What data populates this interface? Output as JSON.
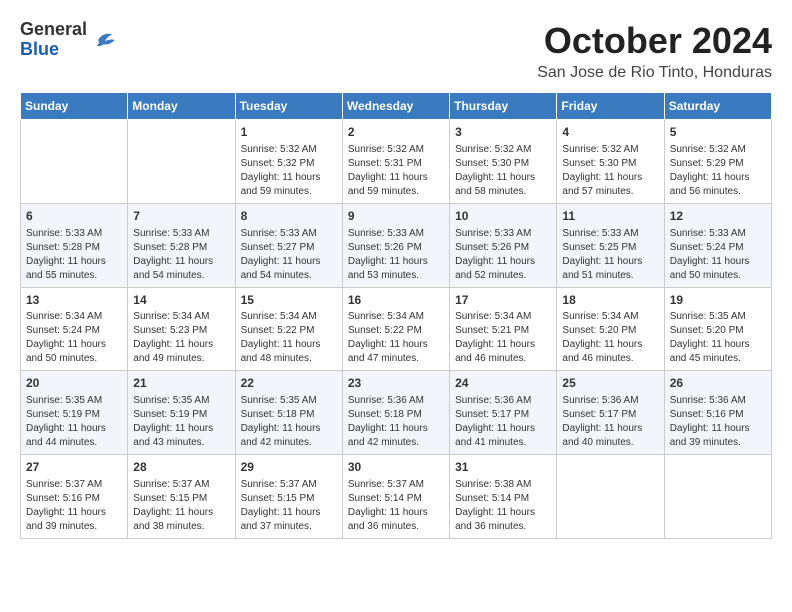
{
  "header": {
    "logo": {
      "line1": "General",
      "line2": "Blue"
    },
    "month_title": "October 2024",
    "location": "San Jose de Rio Tinto, Honduras"
  },
  "weekdays": [
    "Sunday",
    "Monday",
    "Tuesday",
    "Wednesday",
    "Thursday",
    "Friday",
    "Saturday"
  ],
  "weeks": [
    [
      {
        "day": "",
        "info": ""
      },
      {
        "day": "",
        "info": ""
      },
      {
        "day": "1",
        "info": "Sunrise: 5:32 AM\nSunset: 5:32 PM\nDaylight: 11 hours and 59 minutes."
      },
      {
        "day": "2",
        "info": "Sunrise: 5:32 AM\nSunset: 5:31 PM\nDaylight: 11 hours and 59 minutes."
      },
      {
        "day": "3",
        "info": "Sunrise: 5:32 AM\nSunset: 5:30 PM\nDaylight: 11 hours and 58 minutes."
      },
      {
        "day": "4",
        "info": "Sunrise: 5:32 AM\nSunset: 5:30 PM\nDaylight: 11 hours and 57 minutes."
      },
      {
        "day": "5",
        "info": "Sunrise: 5:32 AM\nSunset: 5:29 PM\nDaylight: 11 hours and 56 minutes."
      }
    ],
    [
      {
        "day": "6",
        "info": "Sunrise: 5:33 AM\nSunset: 5:28 PM\nDaylight: 11 hours and 55 minutes."
      },
      {
        "day": "7",
        "info": "Sunrise: 5:33 AM\nSunset: 5:28 PM\nDaylight: 11 hours and 54 minutes."
      },
      {
        "day": "8",
        "info": "Sunrise: 5:33 AM\nSunset: 5:27 PM\nDaylight: 11 hours and 54 minutes."
      },
      {
        "day": "9",
        "info": "Sunrise: 5:33 AM\nSunset: 5:26 PM\nDaylight: 11 hours and 53 minutes."
      },
      {
        "day": "10",
        "info": "Sunrise: 5:33 AM\nSunset: 5:26 PM\nDaylight: 11 hours and 52 minutes."
      },
      {
        "day": "11",
        "info": "Sunrise: 5:33 AM\nSunset: 5:25 PM\nDaylight: 11 hours and 51 minutes."
      },
      {
        "day": "12",
        "info": "Sunrise: 5:33 AM\nSunset: 5:24 PM\nDaylight: 11 hours and 50 minutes."
      }
    ],
    [
      {
        "day": "13",
        "info": "Sunrise: 5:34 AM\nSunset: 5:24 PM\nDaylight: 11 hours and 50 minutes."
      },
      {
        "day": "14",
        "info": "Sunrise: 5:34 AM\nSunset: 5:23 PM\nDaylight: 11 hours and 49 minutes."
      },
      {
        "day": "15",
        "info": "Sunrise: 5:34 AM\nSunset: 5:22 PM\nDaylight: 11 hours and 48 minutes."
      },
      {
        "day": "16",
        "info": "Sunrise: 5:34 AM\nSunset: 5:22 PM\nDaylight: 11 hours and 47 minutes."
      },
      {
        "day": "17",
        "info": "Sunrise: 5:34 AM\nSunset: 5:21 PM\nDaylight: 11 hours and 46 minutes."
      },
      {
        "day": "18",
        "info": "Sunrise: 5:34 AM\nSunset: 5:20 PM\nDaylight: 11 hours and 46 minutes."
      },
      {
        "day": "19",
        "info": "Sunrise: 5:35 AM\nSunset: 5:20 PM\nDaylight: 11 hours and 45 minutes."
      }
    ],
    [
      {
        "day": "20",
        "info": "Sunrise: 5:35 AM\nSunset: 5:19 PM\nDaylight: 11 hours and 44 minutes."
      },
      {
        "day": "21",
        "info": "Sunrise: 5:35 AM\nSunset: 5:19 PM\nDaylight: 11 hours and 43 minutes."
      },
      {
        "day": "22",
        "info": "Sunrise: 5:35 AM\nSunset: 5:18 PM\nDaylight: 11 hours and 42 minutes."
      },
      {
        "day": "23",
        "info": "Sunrise: 5:36 AM\nSunset: 5:18 PM\nDaylight: 11 hours and 42 minutes."
      },
      {
        "day": "24",
        "info": "Sunrise: 5:36 AM\nSunset: 5:17 PM\nDaylight: 11 hours and 41 minutes."
      },
      {
        "day": "25",
        "info": "Sunrise: 5:36 AM\nSunset: 5:17 PM\nDaylight: 11 hours and 40 minutes."
      },
      {
        "day": "26",
        "info": "Sunrise: 5:36 AM\nSunset: 5:16 PM\nDaylight: 11 hours and 39 minutes."
      }
    ],
    [
      {
        "day": "27",
        "info": "Sunrise: 5:37 AM\nSunset: 5:16 PM\nDaylight: 11 hours and 39 minutes."
      },
      {
        "day": "28",
        "info": "Sunrise: 5:37 AM\nSunset: 5:15 PM\nDaylight: 11 hours and 38 minutes."
      },
      {
        "day": "29",
        "info": "Sunrise: 5:37 AM\nSunset: 5:15 PM\nDaylight: 11 hours and 37 minutes."
      },
      {
        "day": "30",
        "info": "Sunrise: 5:37 AM\nSunset: 5:14 PM\nDaylight: 11 hours and 36 minutes."
      },
      {
        "day": "31",
        "info": "Sunrise: 5:38 AM\nSunset: 5:14 PM\nDaylight: 11 hours and 36 minutes."
      },
      {
        "day": "",
        "info": ""
      },
      {
        "day": "",
        "info": ""
      }
    ]
  ]
}
